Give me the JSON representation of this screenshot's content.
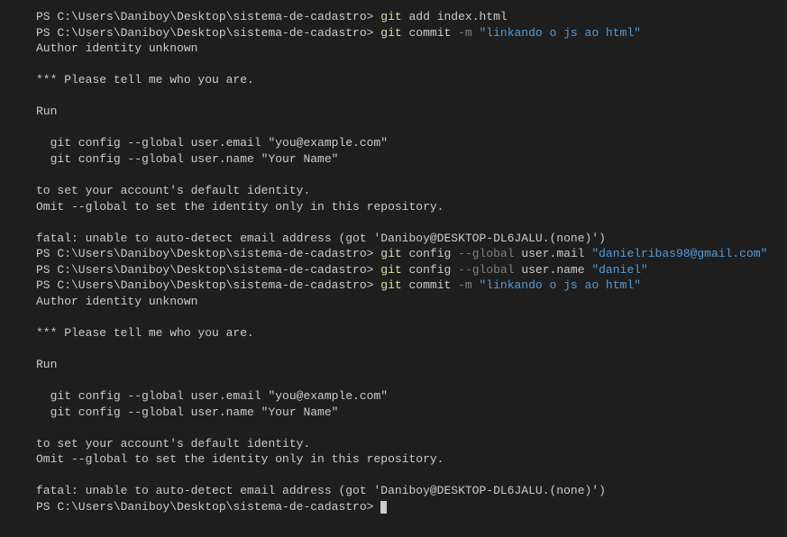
{
  "lines": [
    {
      "type": "command",
      "prompt": "PS C:\\Users\\Daniboy\\Desktop\\sistema-de-cadastro> ",
      "parts": [
        {
          "text": "git ",
          "class": "cmd-yellow"
        },
        {
          "text": "add index.html",
          "class": "output"
        }
      ]
    },
    {
      "type": "command",
      "prompt": "PS C:\\Users\\Daniboy\\Desktop\\sistema-de-cadastro> ",
      "parts": [
        {
          "text": "git ",
          "class": "cmd-yellow"
        },
        {
          "text": "commit ",
          "class": "output"
        },
        {
          "text": "-m ",
          "class": "cmd-gray"
        },
        {
          "text": "\"linkando o js ao html\"",
          "class": "cmd-cyan"
        }
      ]
    },
    {
      "type": "output",
      "text": "Author identity unknown"
    },
    {
      "type": "output",
      "text": ""
    },
    {
      "type": "output",
      "text": "*** Please tell me who you are."
    },
    {
      "type": "output",
      "text": ""
    },
    {
      "type": "output",
      "text": "Run"
    },
    {
      "type": "output",
      "text": ""
    },
    {
      "type": "output",
      "text": "  git config --global user.email \"you@example.com\""
    },
    {
      "type": "output",
      "text": "  git config --global user.name \"Your Name\""
    },
    {
      "type": "output",
      "text": ""
    },
    {
      "type": "output",
      "text": "to set your account's default identity."
    },
    {
      "type": "output",
      "text": "Omit --global to set the identity only in this repository."
    },
    {
      "type": "output",
      "text": ""
    },
    {
      "type": "output",
      "text": "fatal: unable to auto-detect email address (got 'Daniboy@DESKTOP-DL6JALU.(none)')"
    },
    {
      "type": "command",
      "prompt": "PS C:\\Users\\Daniboy\\Desktop\\sistema-de-cadastro> ",
      "parts": [
        {
          "text": "git ",
          "class": "cmd-yellow"
        },
        {
          "text": "config ",
          "class": "output"
        },
        {
          "text": "--global ",
          "class": "cmd-gray"
        },
        {
          "text": "user.mail ",
          "class": "output"
        },
        {
          "text": "\"danielribas98@gmail.com\"",
          "class": "cmd-cyan"
        }
      ]
    },
    {
      "type": "command",
      "prompt": "PS C:\\Users\\Daniboy\\Desktop\\sistema-de-cadastro> ",
      "parts": [
        {
          "text": "git ",
          "class": "cmd-yellow"
        },
        {
          "text": "config ",
          "class": "output"
        },
        {
          "text": "--global ",
          "class": "cmd-gray"
        },
        {
          "text": "user.name ",
          "class": "output"
        },
        {
          "text": "\"daniel\"",
          "class": "cmd-cyan"
        }
      ]
    },
    {
      "type": "command",
      "prompt": "PS C:\\Users\\Daniboy\\Desktop\\sistema-de-cadastro> ",
      "parts": [
        {
          "text": "git ",
          "class": "cmd-yellow"
        },
        {
          "text": "commit ",
          "class": "output"
        },
        {
          "text": "-m ",
          "class": "cmd-gray"
        },
        {
          "text": "\"linkando o js ao html\"",
          "class": "cmd-cyan"
        }
      ]
    },
    {
      "type": "output",
      "text": "Author identity unknown"
    },
    {
      "type": "output",
      "text": ""
    },
    {
      "type": "output",
      "text": "*** Please tell me who you are."
    },
    {
      "type": "output",
      "text": ""
    },
    {
      "type": "output",
      "text": "Run"
    },
    {
      "type": "output",
      "text": ""
    },
    {
      "type": "output",
      "text": "  git config --global user.email \"you@example.com\""
    },
    {
      "type": "output",
      "text": "  git config --global user.name \"Your Name\""
    },
    {
      "type": "output",
      "text": ""
    },
    {
      "type": "output",
      "text": "to set your account's default identity."
    },
    {
      "type": "output",
      "text": "Omit --global to set the identity only in this repository."
    },
    {
      "type": "output",
      "text": ""
    },
    {
      "type": "output",
      "text": "fatal: unable to auto-detect email address (got 'Daniboy@DESKTOP-DL6JALU.(none)')"
    },
    {
      "type": "prompt-cursor",
      "prompt": "PS C:\\Users\\Daniboy\\Desktop\\sistema-de-cadastro> "
    }
  ]
}
